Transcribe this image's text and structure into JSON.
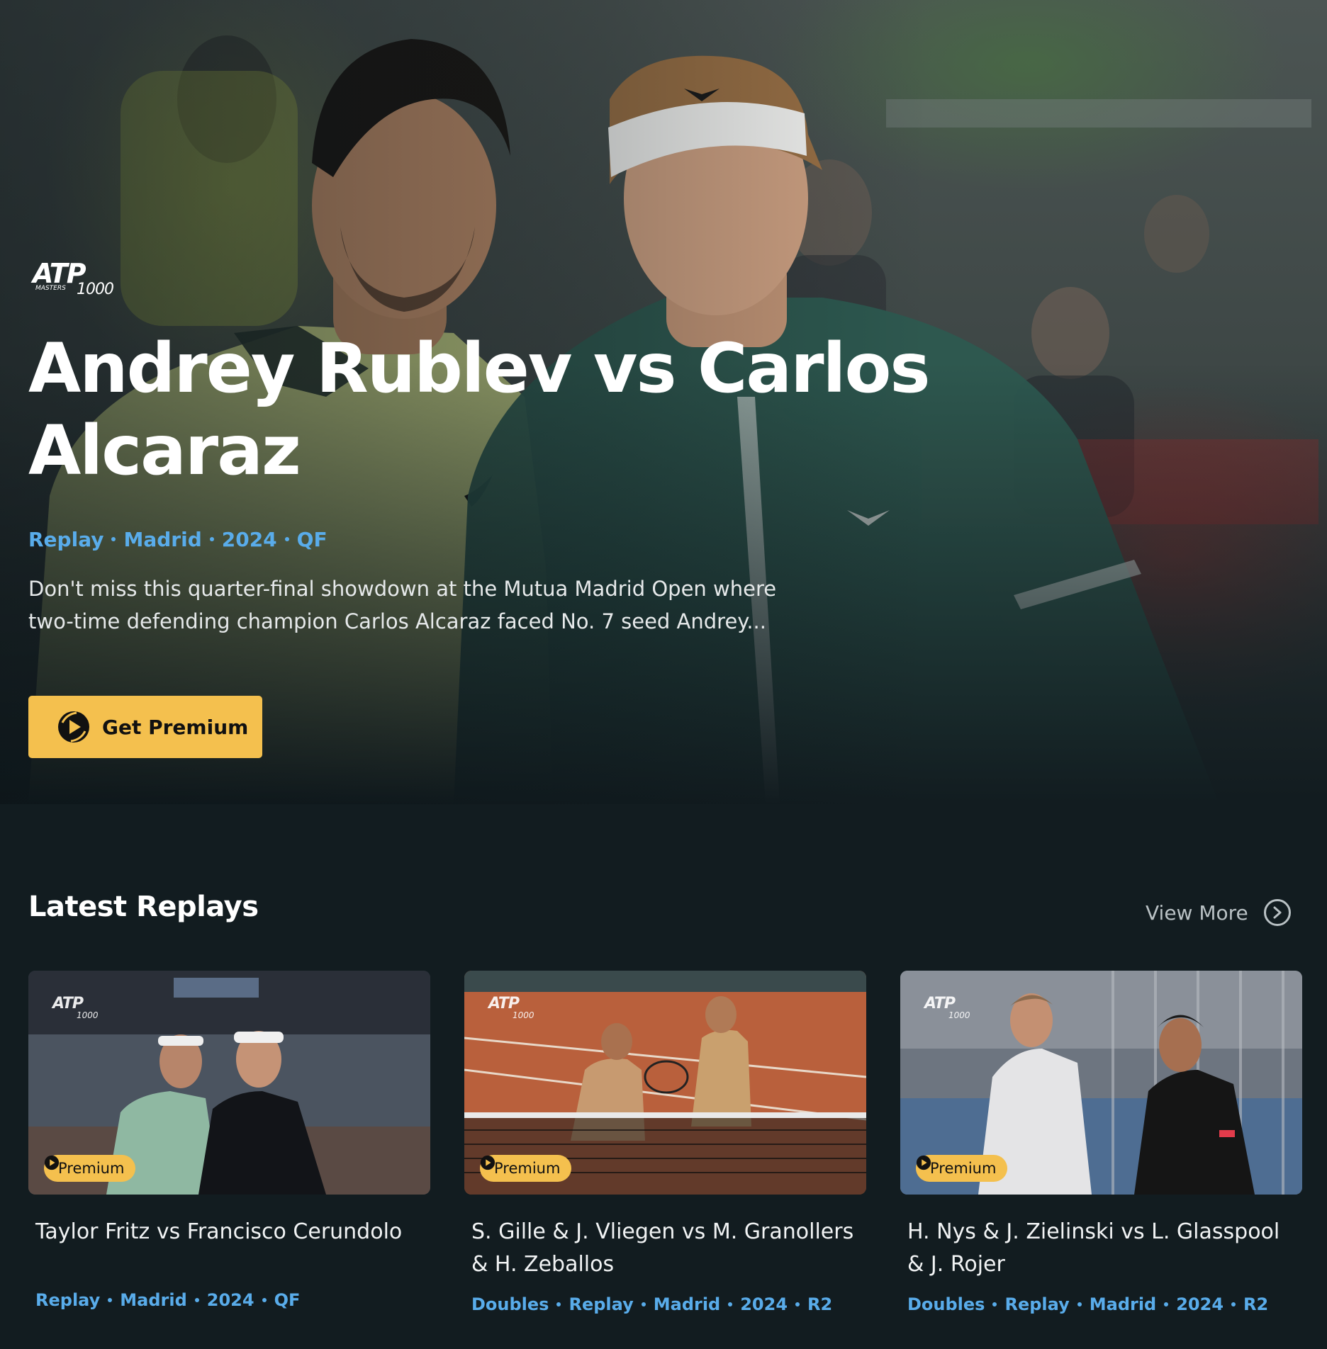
{
  "hero": {
    "logo": {
      "wordmark": "ATP",
      "line": "MASTERS",
      "number": "1000"
    },
    "title": "Andrey Rublev vs Carlos Alcaraz",
    "meta": [
      "Replay",
      "Madrid",
      "2024",
      "QF"
    ],
    "description_line1": "Don't miss this quarter-final showdown at the Mutua Madrid Open where",
    "description_line2": "two-time defending champion Carlos Alcaraz faced No. 7 seed Andrey...",
    "cta_label": "Get Premium",
    "cta_icon": "premium-logo-icon"
  },
  "latest": {
    "title": "Latest Replays",
    "view_more": "View More",
    "view_more_icon": "chevron-right-circle-icon",
    "cards": [
      {
        "title": "Taylor Fritz vs Francisco Cerundolo",
        "badge": "Premium",
        "meta": [
          "Replay",
          "Madrid",
          "2024",
          "QF"
        ]
      },
      {
        "title": "S. Gille & J. Vliegen vs M. Granollers & H. Zeballos",
        "badge": "Premium",
        "meta": [
          "Doubles",
          "Replay",
          "Madrid",
          "2024",
          "R2"
        ]
      },
      {
        "title": "H. Nys & J. Zielinski vs L. Glasspool & J. Rojer",
        "badge": "Premium",
        "meta": [
          "Doubles",
          "Replay",
          "Madrid",
          "2024",
          "R2"
        ]
      }
    ]
  },
  "colors": {
    "background": "#121c20",
    "accent_yellow": "#f4c04e",
    "meta_blue": "#59acea",
    "muted_text": "#b9c1c4"
  }
}
